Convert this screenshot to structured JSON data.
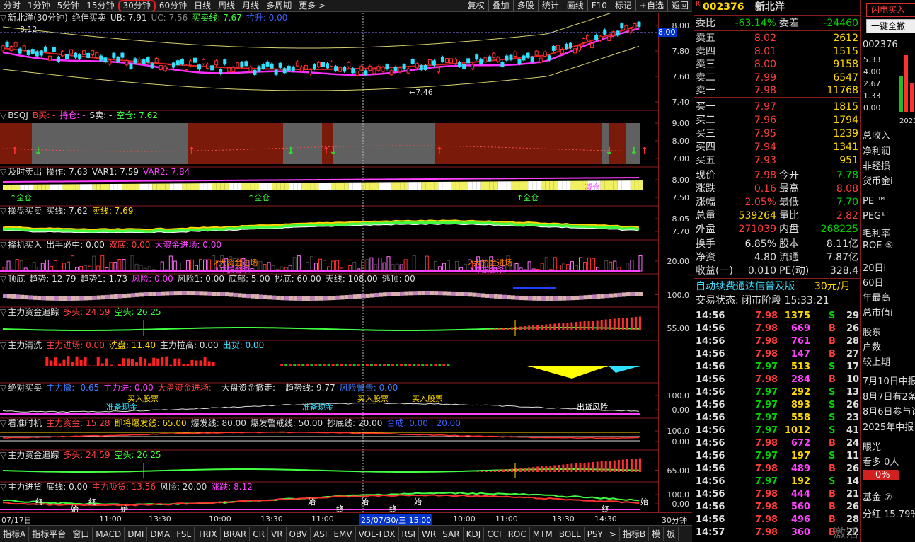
{
  "toolbar": {
    "tabs": [
      "分时",
      "1分钟",
      "5分钟",
      "15分钟",
      "30分钟",
      "60分钟",
      "日线",
      "周线",
      "月线",
      "多周期",
      "更多 >"
    ],
    "active": "30分钟",
    "right": [
      "复权",
      "叠加",
      "多股",
      "统计",
      "画线",
      "F10",
      "标记",
      "+自选",
      "返回"
    ]
  },
  "panes": [
    {
      "id": "main",
      "title": "新北洋(30分钟)",
      "items": [
        {
          "t": "绝佳买卖",
          "c": "#ddd"
        },
        {
          "t": "UB: 7.91",
          "c": "#ddd"
        },
        {
          "t": "UC: 7.56",
          "c": "#888"
        },
        {
          "t": "买卖线: 7.67",
          "c": "#40ff40"
        },
        {
          "t": "拉升: 0.00",
          "c": "#4060ff"
        }
      ],
      "labels": [
        "8.00",
        "7.80",
        "7.60",
        "7.40"
      ],
      "notes": [
        "8.12",
        "7.46"
      ]
    },
    {
      "id": "bsqj",
      "title": "BSQJ",
      "items": [
        {
          "t": "B买: -",
          "c": "#ff4040"
        },
        {
          "t": "持仓: -",
          "c": "#ff40ff"
        },
        {
          "t": "S卖: -",
          "c": "#ddd"
        },
        {
          "t": "空仓: 7.62",
          "c": "#40ff40"
        }
      ],
      "labels": [
        "9.00",
        "8.00",
        "7.00"
      ]
    },
    {
      "id": "jsmc",
      "title": "及时卖出",
      "items": [
        {
          "t": "操作: 7.63",
          "c": "#ddd"
        },
        {
          "t": "VAR1: 7.59",
          "c": "#ddd"
        },
        {
          "t": "VAR2: 7.84",
          "c": "#ff40ff"
        }
      ],
      "labels": [
        "8.00",
        "7.50"
      ],
      "notes": [
        "全仓",
        "全仓",
        "全仓",
        "减仓"
      ]
    },
    {
      "id": "cpmm",
      "title": "操盘买卖",
      "items": [
        {
          "t": "买线: 7.62",
          "c": "#ddd"
        },
        {
          "t": "卖线: 7.69",
          "c": "#ffd800"
        }
      ],
      "labels": [
        "8.05",
        "7.70"
      ]
    },
    {
      "id": "zjmr",
      "title": "择机买入",
      "items": [
        {
          "t": "出手必中: 0.00",
          "c": "#ddd"
        },
        {
          "t": "双底: 0.00",
          "c": "#ff4040"
        },
        {
          "t": "大资金进场: 0.00",
          "c": "#ff40ff"
        }
      ],
      "labels": [
        "20.00"
      ],
      "notes": [
        "大资金进场",
        "冲拔合杀",
        "大资金进场",
        "冲拔合杀"
      ]
    },
    {
      "id": "dd",
      "title": "顶底",
      "items": [
        {
          "t": "趋势: 12.79",
          "c": "#ddd"
        },
        {
          "t": "趋势1:-1.73",
          "c": "#ddd"
        },
        {
          "t": "风险: 0.00",
          "c": "#ff40ff"
        },
        {
          "t": "风险1: 0.00",
          "c": "#ddd"
        },
        {
          "t": "底部: 5.00",
          "c": "#ddd"
        },
        {
          "t": "抄底: 60.00",
          "c": "#ddd"
        },
        {
          "t": "天线: 108.00",
          "c": "#ddd"
        },
        {
          "t": "逃顶: 00",
          "c": "#ddd"
        }
      ],
      "labels": [
        "100.0"
      ]
    },
    {
      "id": "zlzj1",
      "title": "主力资金追踪",
      "items": [
        {
          "t": "多头: 24.59",
          "c": "#ff4040"
        },
        {
          "t": "空头: 26.25",
          "c": "#40ff40"
        }
      ],
      "labels": [
        "55.00"
      ]
    },
    {
      "id": "zlqx",
      "title": "主力清洗",
      "items": [
        {
          "t": "主力进场: 0.00",
          "c": "#ff4040"
        },
        {
          "t": "洗盘: 11.40",
          "c": "#ffd800"
        },
        {
          "t": "主力拉高: 0.00",
          "c": "#ddd"
        },
        {
          "t": "出货: 0.00",
          "c": "#40e0ff"
        }
      ],
      "labels": []
    },
    {
      "id": "jdmm",
      "title": "绝对买卖",
      "items": [
        {
          "t": "主力撤: -0.65",
          "c": "#4080ff"
        },
        {
          "t": "主力进: 0.00",
          "c": "#ff40ff"
        },
        {
          "t": "大盘资金进场: -",
          "c": "#ff4040"
        },
        {
          "t": "大盘资金撤走: -",
          "c": "#ddd"
        },
        {
          "t": "趋势线: 9.77",
          "c": "#ddd"
        },
        {
          "t": "风险警告: 0.00",
          "c": "#4080ff"
        }
      ],
      "labels": [
        "100.0",
        "0.00"
      ],
      "notes": [
        "买入股票",
        "准备现金",
        "买入股票",
        "准备现金",
        "买入股票",
        "出货风险"
      ]
    },
    {
      "id": "kzsj",
      "title": "看准时机",
      "items": [
        {
          "t": "主力资金: 15.28",
          "c": "#ff4040"
        },
        {
          "t": "即将爆发线: 65.00",
          "c": "#ffd800"
        },
        {
          "t": "爆发线: 80.00",
          "c": "#ddd"
        },
        {
          "t": "爆发警戒线: 50.00",
          "c": "#ddd"
        },
        {
          "t": "抄底线: 20.00",
          "c": "#ddd"
        },
        {
          "t": "合成: 0.00 : 20.00",
          "c": "#4060ff"
        }
      ],
      "labels": [
        "100.0",
        "0.00"
      ]
    },
    {
      "id": "zlzj2",
      "title": "主力资金追踪",
      "items": [
        {
          "t": "多头: 24.59",
          "c": "#ff4040"
        },
        {
          "t": "空头: 26.25",
          "c": "#40ff40"
        }
      ],
      "labels": [
        "65.00"
      ]
    },
    {
      "id": "zljh",
      "title": "主力进货",
      "items": [
        {
          "t": "底线: 0.00",
          "c": "#ddd"
        },
        {
          "t": "主力吸货: 13.56",
          "c": "#ff4040"
        },
        {
          "t": "风险: 20.00",
          "c": "#ddd"
        },
        {
          "t": "涨跌: 8.12",
          "c": "#ff40ff"
        }
      ],
      "labels": [
        "100.0",
        "0.00"
      ],
      "notes": [
        "终",
        "始",
        "终",
        "始",
        "始",
        "终",
        "始",
        "终",
        "始",
        "终",
        "始"
      ]
    }
  ],
  "xaxis": {
    "labels": [
      "07/17日",
      "11:00",
      "13:30",
      "10:00",
      "13:30",
      "11:00",
      "10:00",
      "25/07/30/三 15:00",
      "10:00",
      "11:00",
      "13:30",
      "14:30"
    ],
    "period": "30分钟"
  },
  "bottom_tabs": [
    "指标A",
    "指标平台",
    "窗口",
    "MACD",
    "DMI",
    "DMA",
    "FSL",
    "TRIX",
    "BRAR",
    "CR",
    "VR",
    "OBV",
    "ASI",
    "EMV",
    "VOL-TDX",
    "RSI",
    "WR",
    "SAR",
    "KDJ",
    "CCI",
    "ROC",
    "MTM",
    "BOLL",
    "PSY",
    ">",
    "指标B",
    "模",
    "板"
  ],
  "quote": {
    "code": "002376",
    "name": "新北洋",
    "weibi": {
      "label": "委比",
      "val": "-63.14%",
      "label2": "委差",
      "val2": "-24460"
    },
    "asks": [
      {
        "l": "卖五",
        "p": "8.02",
        "v": "2612"
      },
      {
        "l": "卖四",
        "p": "8.01",
        "v": "1515"
      },
      {
        "l": "卖三",
        "p": "8.00",
        "v": "9158"
      },
      {
        "l": "卖二",
        "p": "7.99",
        "v": "6547"
      },
      {
        "l": "卖一",
        "p": "7.98",
        "v": "11768"
      }
    ],
    "bids": [
      {
        "l": "买一",
        "p": "7.97",
        "v": "1815"
      },
      {
        "l": "买二",
        "p": "7.96",
        "v": "1794"
      },
      {
        "l": "买三",
        "p": "7.95",
        "v": "1239"
      },
      {
        "l": "买四",
        "p": "7.94",
        "v": "1341"
      },
      {
        "l": "买五",
        "p": "7.93",
        "v": "951"
      }
    ],
    "stats": [
      {
        "l": "现价",
        "v": "7.98",
        "l2": "今开",
        "v2": "7.78",
        "c1": "red",
        "c2": "green"
      },
      {
        "l": "涨跌",
        "v": "0.16",
        "l2": "最高",
        "v2": "8.08",
        "c1": "red",
        "c2": "red"
      },
      {
        "l": "涨幅",
        "v": "2.05%",
        "l2": "最低",
        "v2": "7.70",
        "c1": "red",
        "c2": "green"
      },
      {
        "l": "总量",
        "v": "539264",
        "l2": "量比",
        "v2": "2.82",
        "c1": "yel",
        "c2": "red"
      },
      {
        "l": "外盘",
        "v": "271039",
        "l2": "内盘",
        "v2": "268225",
        "c1": "red",
        "c2": "green"
      }
    ],
    "stats2": [
      {
        "l": "换手",
        "v": "6.85%",
        "l2": "股本",
        "v2": "8.11亿"
      },
      {
        "l": "净资",
        "v": "4.80",
        "l2": "流通",
        "v2": "7.87亿"
      },
      {
        "l": "收益(一)",
        "v": "0.010",
        "l2": "PE(动)",
        "v2": "328.4"
      }
    ],
    "ad": "自动续费通达信普及版",
    "ad_price": "30元/月",
    "status": "交易状态: 闭市阶段 15:33:21",
    "ticks": [
      {
        "t": "14:56",
        "p": "7.98",
        "v": "1375",
        "s": "S",
        "n": "29"
      },
      {
        "t": "14:56",
        "p": "7.98",
        "v": "669",
        "s": "B",
        "n": "26"
      },
      {
        "t": "14:56",
        "p": "7.98",
        "v": "761",
        "s": "B",
        "n": "28"
      },
      {
        "t": "14:56",
        "p": "7.98",
        "v": "147",
        "s": "B",
        "n": "27"
      },
      {
        "t": "14:56",
        "p": "7.97",
        "v": "513",
        "s": "S",
        "n": "17"
      },
      {
        "t": "14:56",
        "p": "7.98",
        "v": "284",
        "s": "B",
        "n": "10"
      },
      {
        "t": "14:56",
        "p": "7.97",
        "v": "292",
        "s": "S",
        "n": "13"
      },
      {
        "t": "14:56",
        "p": "7.97",
        "v": "893",
        "s": "S",
        "n": "26"
      },
      {
        "t": "14:56",
        "p": "7.97",
        "v": "558",
        "s": "S",
        "n": "23"
      },
      {
        "t": "14:56",
        "p": "7.97",
        "v": "1012",
        "s": "S",
        "n": "41"
      },
      {
        "t": "14:56",
        "p": "7.98",
        "v": "672",
        "s": "B",
        "n": "24"
      },
      {
        "t": "14:56",
        "p": "7.97",
        "v": "197",
        "s": "S",
        "n": "11"
      },
      {
        "t": "14:56",
        "p": "7.98",
        "v": "489",
        "s": "B",
        "n": "26"
      },
      {
        "t": "14:56",
        "p": "7.97",
        "v": "192",
        "s": "S",
        "n": "14"
      },
      {
        "t": "14:56",
        "p": "7.98",
        "v": "444",
        "s": "B",
        "n": "21"
      },
      {
        "t": "14:56",
        "p": "7.98",
        "v": "560",
        "s": "B",
        "n": "26"
      },
      {
        "t": "14:56",
        "p": "7.98",
        "v": "496",
        "s": "B",
        "n": "28"
      },
      {
        "t": "14:57",
        "p": "7.98",
        "v": "360",
        "s": "B",
        "n": "22"
      }
    ]
  },
  "side": {
    "btn1": "闪电买入",
    "btn2": "一键全撤",
    "code": "002376",
    "axis": [
      "5.33",
      "4.00",
      "2.67",
      "1.33",
      "0.00"
    ],
    "year": "2025",
    "items": [
      "总收入",
      "净利润",
      "非经损",
      "货币金i",
      "PE ™",
      "PEG¹",
      "毛利率",
      "ROE ⑤",
      "20日i",
      "60日",
      "年最高",
      "总市值i",
      "股东",
      "户数",
      "较上期",
      "7月10日中报",
      "8月7日有2条",
      "8月6日参与讨",
      "2025年中报",
      "眼光",
      "看多 0人",
      "0%",
      "基金 ⑦",
      "分红 15.79%"
    ],
    "partial": [
      "4",
      "8",
      "2",
      "6",
      "2",
      "2",
      "64",
      "2"
    ]
  },
  "watermark": "激活 Windows"
}
